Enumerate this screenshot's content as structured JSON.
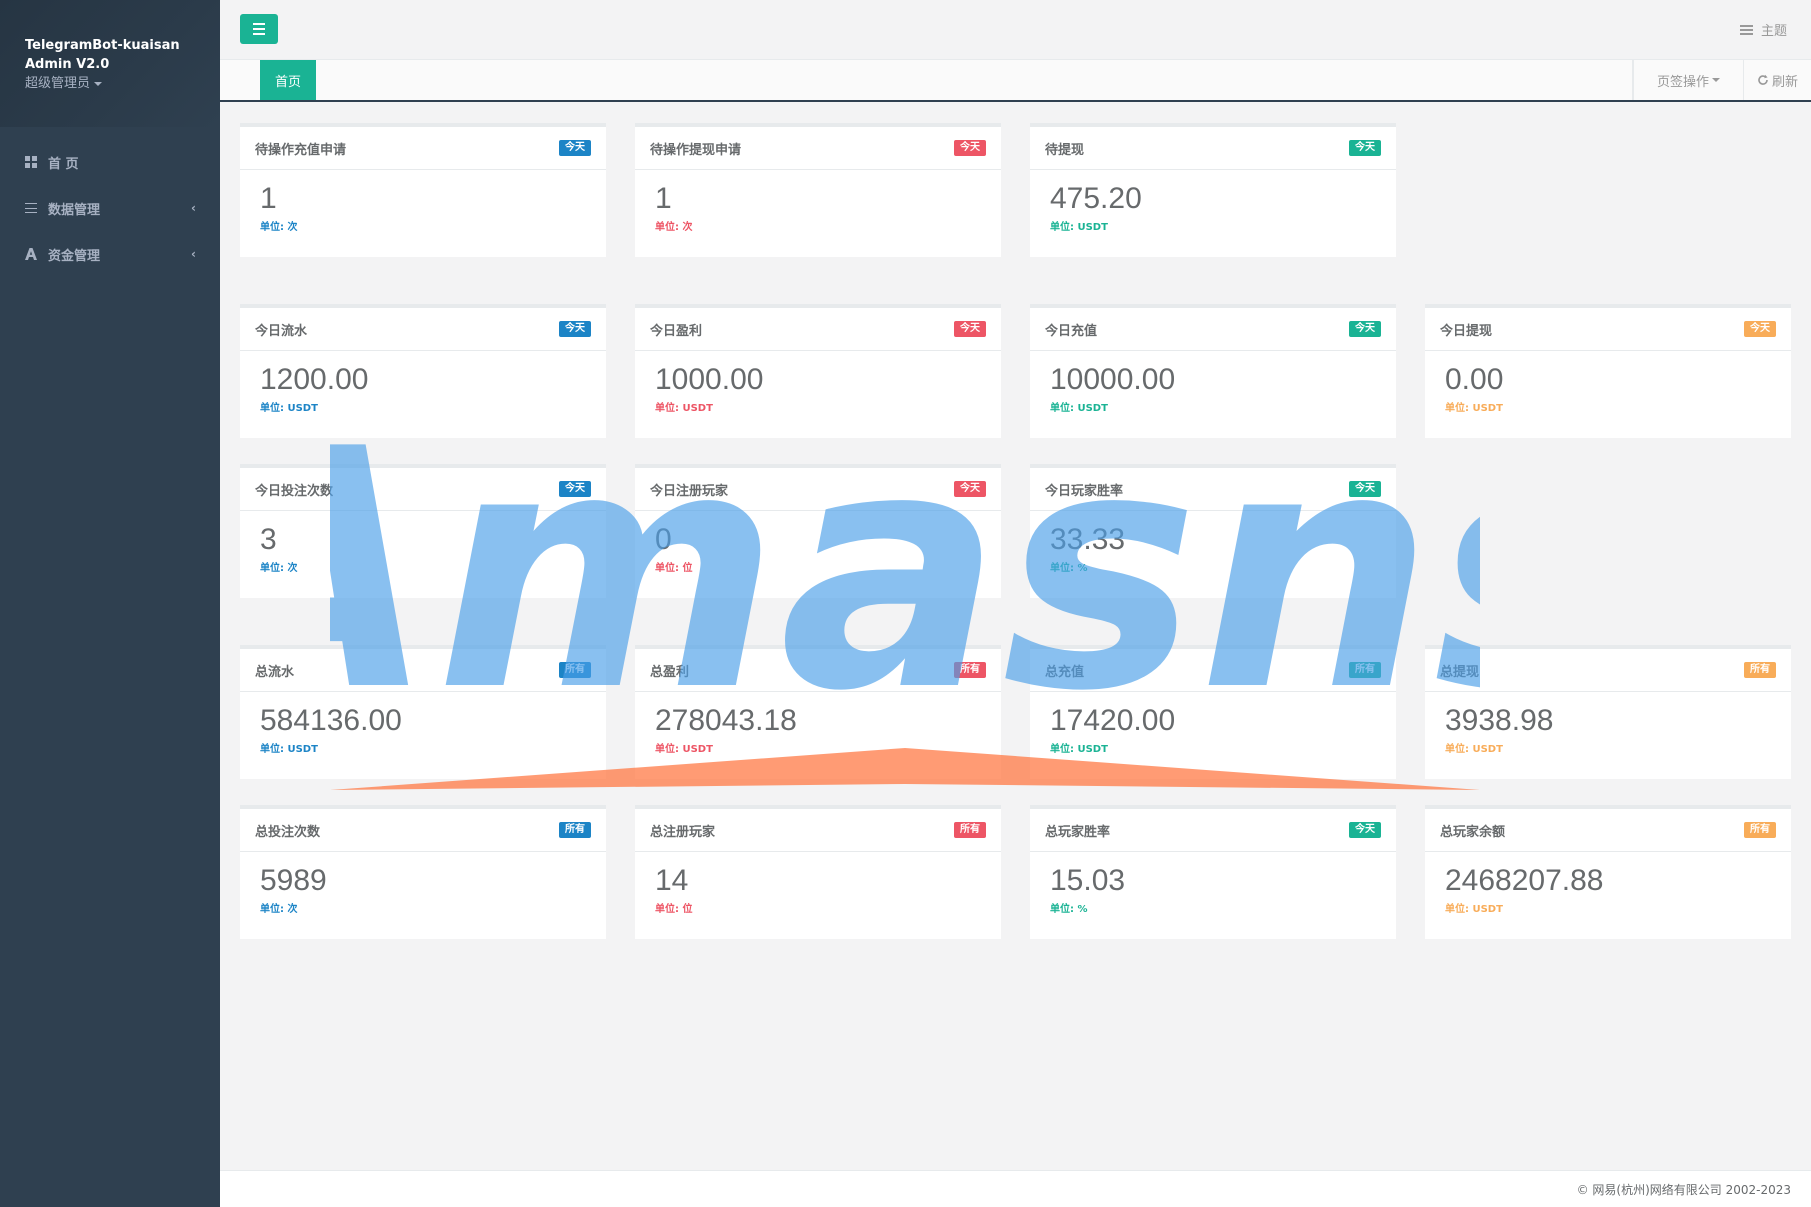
{
  "sidebar": {
    "brand_line1": "TelegramBot-kuaisan",
    "brand_line2": "Admin V2.0",
    "role": "超级管理员",
    "items": [
      {
        "label": "首 页",
        "icon": "grid-icon"
      },
      {
        "label": "数据管理",
        "icon": "list-icon"
      },
      {
        "label": "资金管理",
        "icon": "font-icon"
      }
    ]
  },
  "topbar": {
    "theme_label": "主题"
  },
  "tabs": {
    "home_label": "首页",
    "ops_label": "页签操作",
    "refresh_label": "刷新"
  },
  "cards": [
    {
      "title": "待操作充值申请",
      "badge": "今天",
      "color": "blue",
      "value": "1",
      "unit": "单位: 次"
    },
    {
      "title": "待操作提现申请",
      "badge": "今天",
      "color": "red",
      "value": "1",
      "unit": "单位: 次"
    },
    {
      "title": "待提现",
      "badge": "今天",
      "color": "green",
      "value": "475.20",
      "unit": "单位: USDT"
    },
    {
      "title": "今日流水",
      "badge": "今天",
      "color": "blue",
      "value": "1200.00",
      "unit": "单位: USDT"
    },
    {
      "title": "今日盈利",
      "badge": "今天",
      "color": "red",
      "value": "1000.00",
      "unit": "单位: USDT"
    },
    {
      "title": "今日充值",
      "badge": "今天",
      "color": "green",
      "value": "10000.00",
      "unit": "单位: USDT"
    },
    {
      "title": "今日提现",
      "badge": "今天",
      "color": "orange",
      "value": "0.00",
      "unit": "单位: USDT"
    },
    {
      "title": "今日投注次数",
      "badge": "今天",
      "color": "blue",
      "value": "3",
      "unit": "单位: 次"
    },
    {
      "title": "今日注册玩家",
      "badge": "今天",
      "color": "red",
      "value": "0",
      "unit": "单位: 位"
    },
    {
      "title": "今日玩家胜率",
      "badge": "今天",
      "color": "green",
      "value": "33.33",
      "unit": "单位: %"
    },
    {
      "title": "总流水",
      "badge": "所有",
      "color": "blue",
      "value": "584136.00",
      "unit": "单位: USDT"
    },
    {
      "title": "总盈利",
      "badge": "所有",
      "color": "red",
      "value": "278043.18",
      "unit": "单位: USDT"
    },
    {
      "title": "总充值",
      "badge": "所有",
      "color": "green",
      "value": "17420.00",
      "unit": "单位: USDT"
    },
    {
      "title": "总提现",
      "badge": "所有",
      "color": "orange",
      "value": "3938.98",
      "unit": "单位: USDT"
    },
    {
      "title": "总投注次数",
      "badge": "所有",
      "color": "blue",
      "value": "5989",
      "unit": "单位: 次"
    },
    {
      "title": "总注册玩家",
      "badge": "所有",
      "color": "red",
      "value": "14",
      "unit": "单位: 位"
    },
    {
      "title": "总玩家胜率",
      "badge": "今天",
      "color": "green",
      "value": "15.03",
      "unit": "单位: %"
    },
    {
      "title": "总玩家余额",
      "badge": "所有",
      "color": "orange",
      "value": "2468207.88",
      "unit": "单位: USDT"
    }
  ],
  "watermark": {
    "text": "Amasns"
  },
  "footer": {
    "copyright": "© 网易(杭州)网络有限公司 2002-2023"
  },
  "colors": {
    "sidebar_bg": "#2f4050",
    "accent_green": "#1ab394",
    "blue": "#1c84c6",
    "red": "#ed5565",
    "orange": "#f8ac59",
    "watermark_blue": "#4a9ee8",
    "watermark_orange": "#ff7a45"
  }
}
